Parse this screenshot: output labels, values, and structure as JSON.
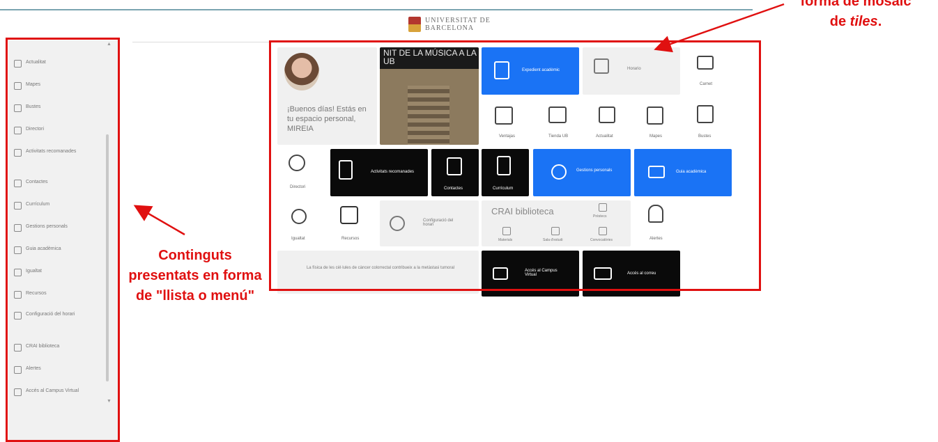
{
  "header": {
    "logo_line1": "UNIVERSITAT DE",
    "logo_line2": "BARCELONA"
  },
  "sidebar": {
    "items": [
      {
        "label": "Actualitat",
        "icon": "newspaper-icon"
      },
      {
        "label": "Mapes",
        "icon": "map-icon"
      },
      {
        "label": "Bustes",
        "icon": "mailbox-icon"
      },
      {
        "label": "Directori",
        "icon": "search-icon"
      },
      {
        "label": "Activitats recomanades",
        "icon": "document-icon"
      },
      {
        "label": "Contactes",
        "icon": "contact-card-icon"
      },
      {
        "label": "Currículum",
        "icon": "cv-icon"
      },
      {
        "label": "Gestions personals",
        "icon": "user-gear-icon"
      },
      {
        "label": "Guia acadèmica",
        "icon": "laptop-icon"
      },
      {
        "label": "Igualtat",
        "icon": "gender-icon"
      },
      {
        "label": "Recursos",
        "icon": "tools-icon"
      },
      {
        "label": "Configuració del horari",
        "icon": "clock-gear-icon"
      },
      {
        "label": "CRAI biblioteca",
        "icon": "book-icon"
      },
      {
        "label": "Alertes",
        "icon": "bell-icon"
      },
      {
        "label": "Accés al Campus Virtual",
        "icon": "monitor-icon"
      }
    ]
  },
  "tiles": {
    "greeting": "¡Buenos días! Estás en tu espacio personal, MIREIA",
    "poster_title": "NIT DE LA MÚSICA A LA UB",
    "expedient": "Expedient acadèmic",
    "horari": "Horario",
    "carnet": "Carnet",
    "ventajas": "Ventajas",
    "botiga": "Tienda UB",
    "actualitat": "Actualitat",
    "mapes": "Mapes",
    "bustes": "Bustes",
    "directori": "Directori",
    "activitats": "Activitats recomanades",
    "contactes": "Contactes",
    "curriculum": "Currículum",
    "gestions": "Gestions personals",
    "guia": "Guia acadèmica",
    "igualtat": "Igualtat",
    "recursos": "Recursos",
    "configuracio": "Configuració del horari",
    "crai": "CRAI biblioteca",
    "crai_sub1": "Préstecs",
    "crai_sub2": "Materials",
    "crai_sub3": "Sala d'estudi",
    "crai_sub4": "Convocatòries",
    "alertes": "Alertes",
    "news": "La física de les cèl·lules de càncer colorrectal contribueix a la metàstasi tumoral",
    "campus": "Accés al Campus Virtual",
    "correu": "Accés al correu"
  },
  "annotations": {
    "list_label": "Continguts presentats en forma de \"llista o menú\"",
    "mosaic_line1": "forma de mosaic",
    "mosaic_line2_prefix": "de ",
    "mosaic_line2_em": "tiles",
    "mosaic_line2_suffix": "."
  },
  "colors": {
    "annotation": "#e01010",
    "tile_blue": "#1a73f5",
    "tile_black": "#0a0a0a"
  }
}
